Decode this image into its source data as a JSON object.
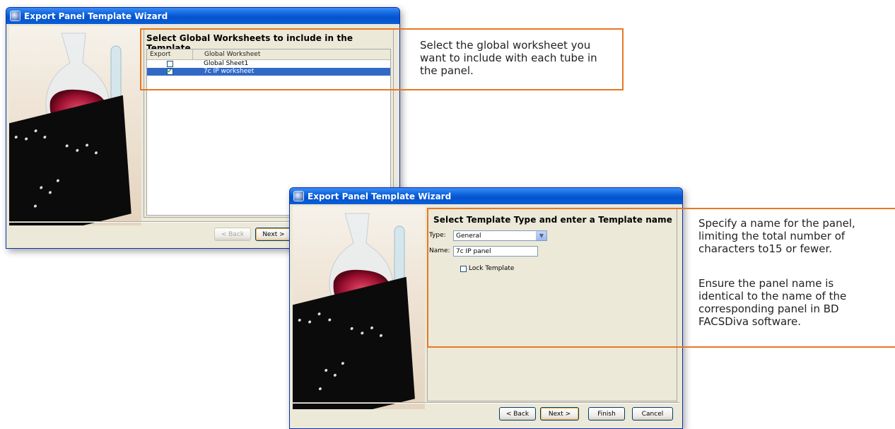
{
  "dialog1": {
    "title": "Export Panel Template Wizard",
    "header": "Select Global Worksheets to include in the Template",
    "columns": [
      "Export",
      "Global Worksheet"
    ],
    "rows": [
      {
        "checked": false,
        "name": "Global Sheet1",
        "selected": false
      },
      {
        "checked": true,
        "name": "7c IP worksheet",
        "selected": true
      }
    ],
    "back_label": "< Back",
    "next_label": "Next >"
  },
  "dialog2": {
    "title": "Export Panel Template Wizard",
    "header": "Select Template Type and enter a Template name",
    "type_label": "Type:",
    "type_value": "General",
    "name_label": "Name:",
    "name_value": "7c IP panel",
    "lock_label": "Lock Template",
    "lock_checked": false,
    "back_label": "< Back",
    "next_label": "Next >",
    "finish_label": "Finish",
    "cancel_label": "Cancel"
  },
  "callouts": {
    "c1": "Select the global worksheet you want to include with each tube in the panel.",
    "c2a": "Specify a name for the panel, limiting the total number of characters to15 or fewer.",
    "c2b": "Ensure the panel name is identical to the name of the corresponding panel in BD FACSDiva software."
  },
  "colors": {
    "accent": "#e87722",
    "titlebar": "#0a5ed8",
    "selection": "#316ac5"
  }
}
